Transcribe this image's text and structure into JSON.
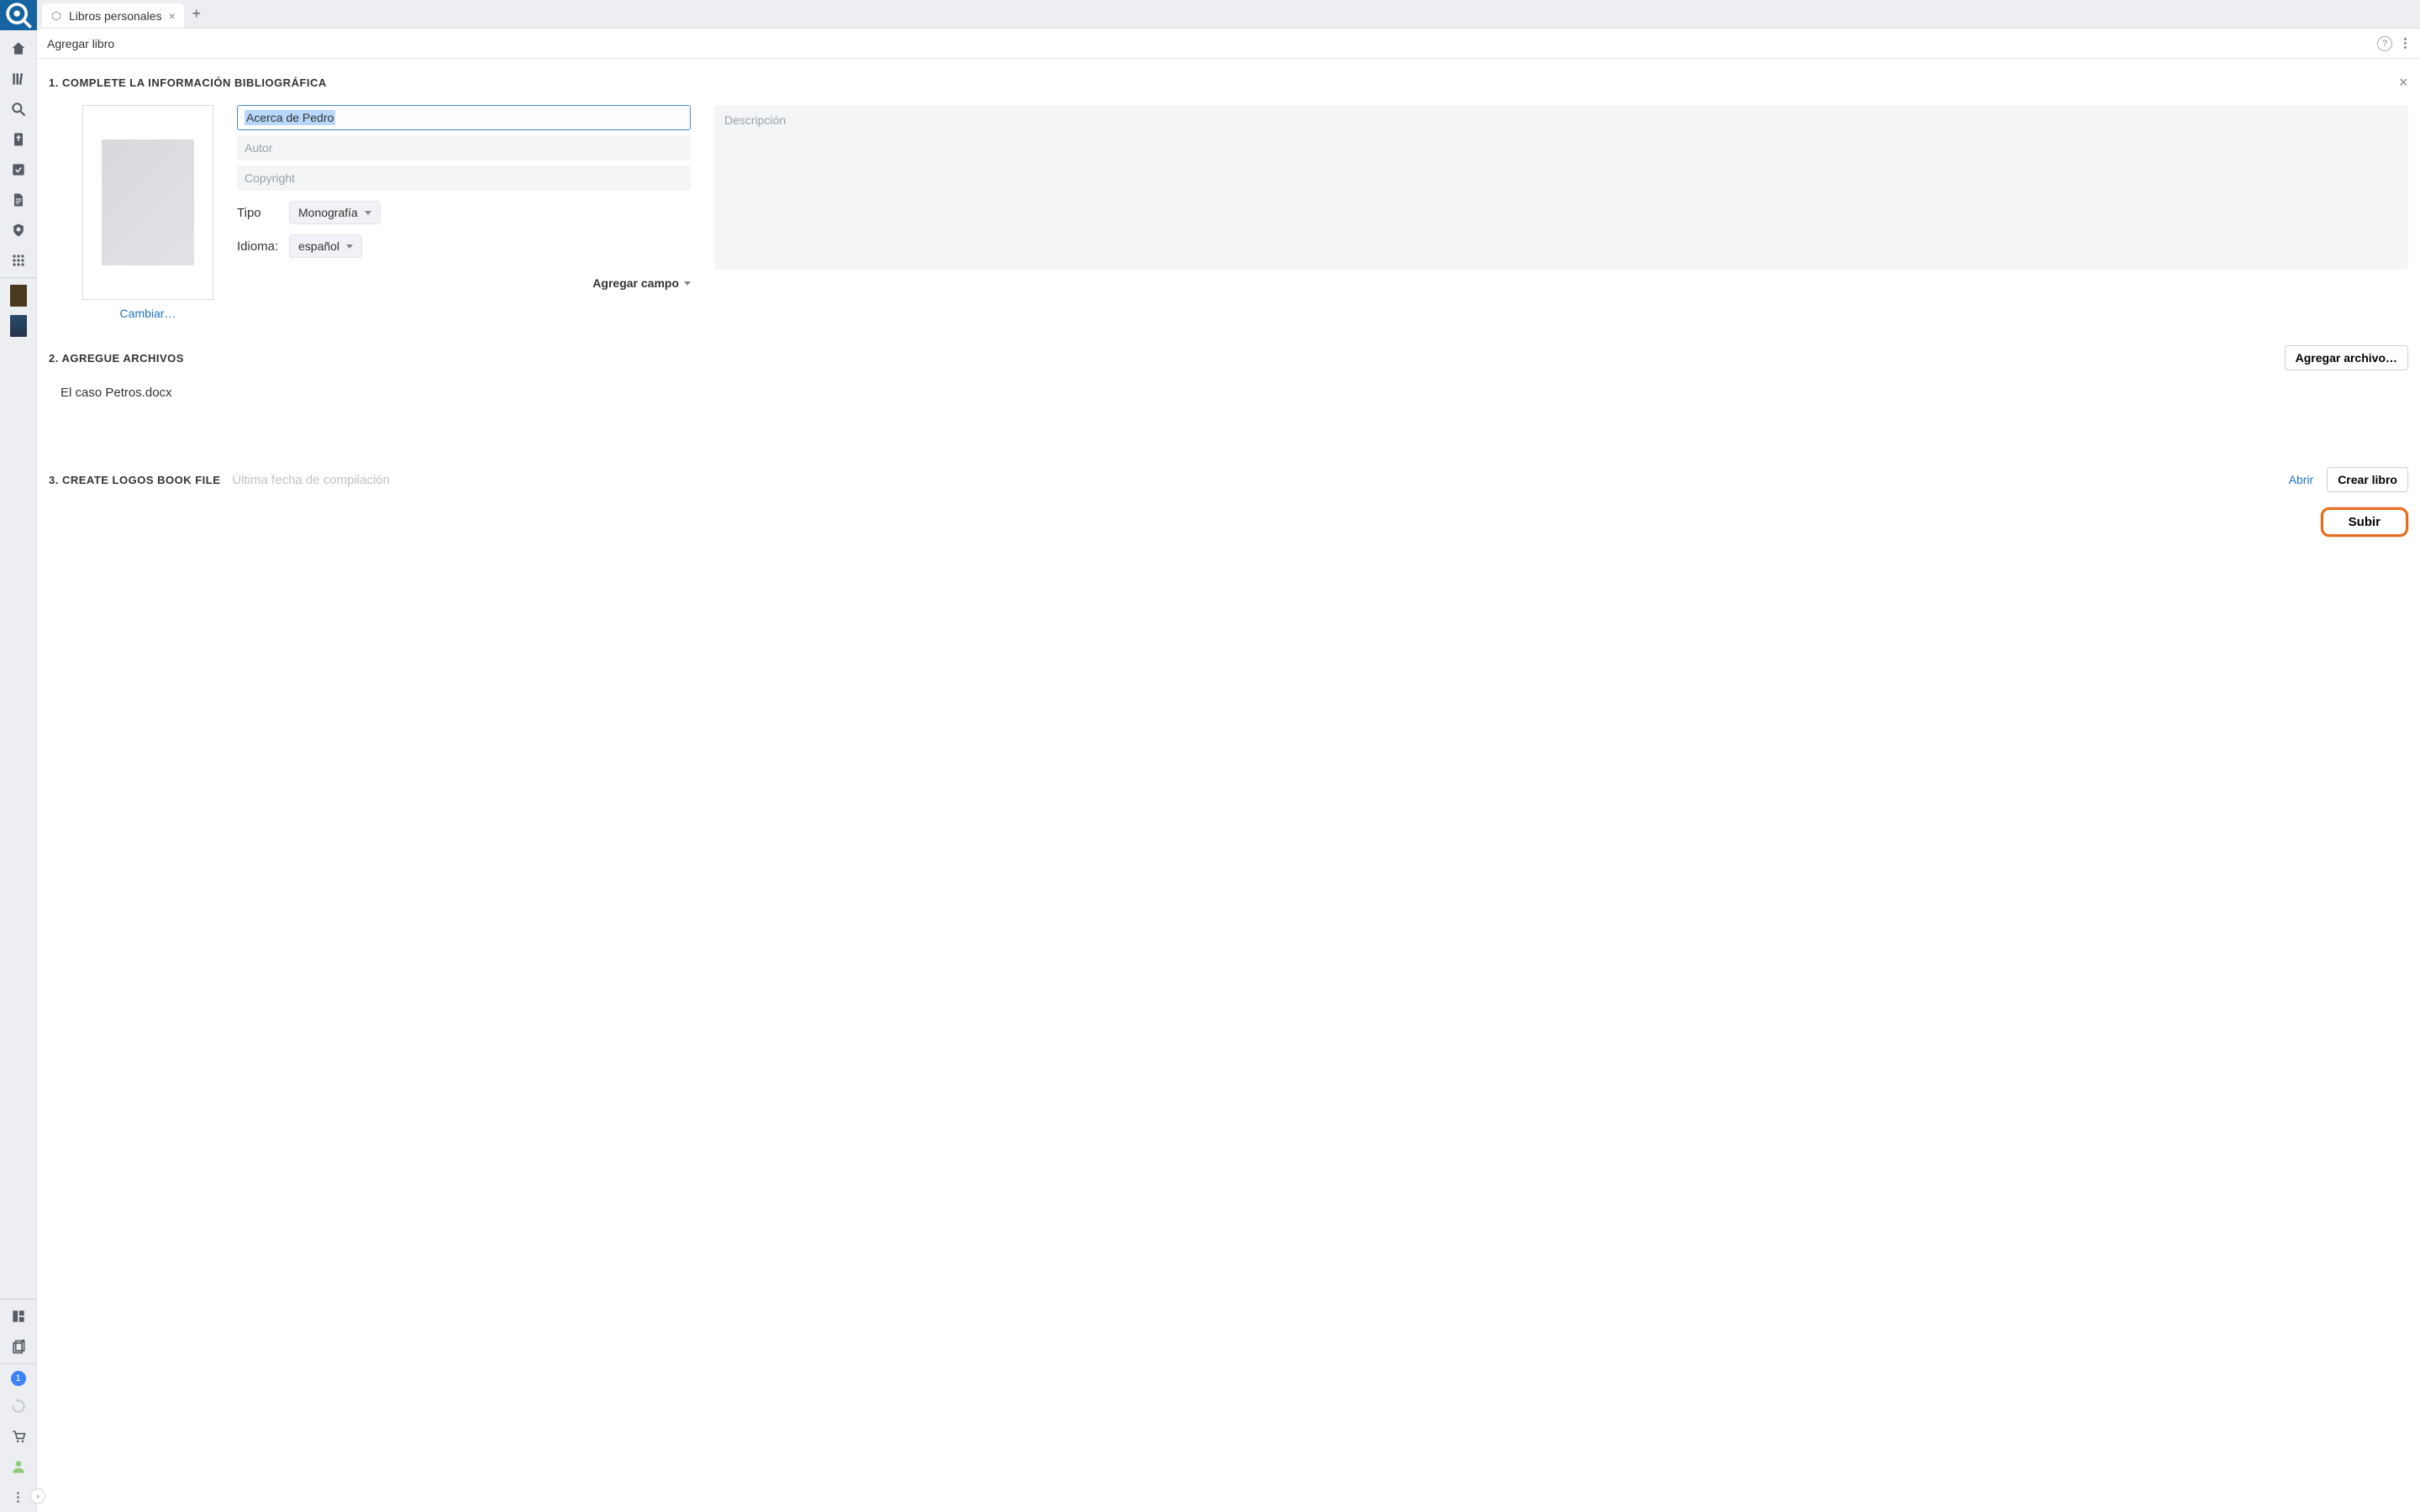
{
  "tab": {
    "label": "Libros personales"
  },
  "page": {
    "title": "Agregar libro"
  },
  "section1": {
    "heading": "1. COMPLETE LA INFORMACIÓN BIBLIOGRÁFICA",
    "change_link": "Cambiar…",
    "title_value": "Acerca de Pedro",
    "author_placeholder": "Autor",
    "copyright_placeholder": "Copyright",
    "type_label": "Tipo",
    "type_value": "Monografía",
    "language_label": "Idioma:",
    "language_value": "español",
    "add_field_label": "Agregar campo",
    "description_placeholder": "Descripción"
  },
  "section2": {
    "heading": "2. AGREGUE ARCHIVOS",
    "add_file_button": "Agregar archivo…",
    "files": [
      "El caso Petros.docx"
    ]
  },
  "section3": {
    "heading": "3. CREATE LOGOS BOOK FILE",
    "last_compile_label": "Última fecha de compilación",
    "open_link": "Abrir",
    "create_button": "Crear libro",
    "upload_button": "Subir"
  },
  "rail_badge": "1"
}
